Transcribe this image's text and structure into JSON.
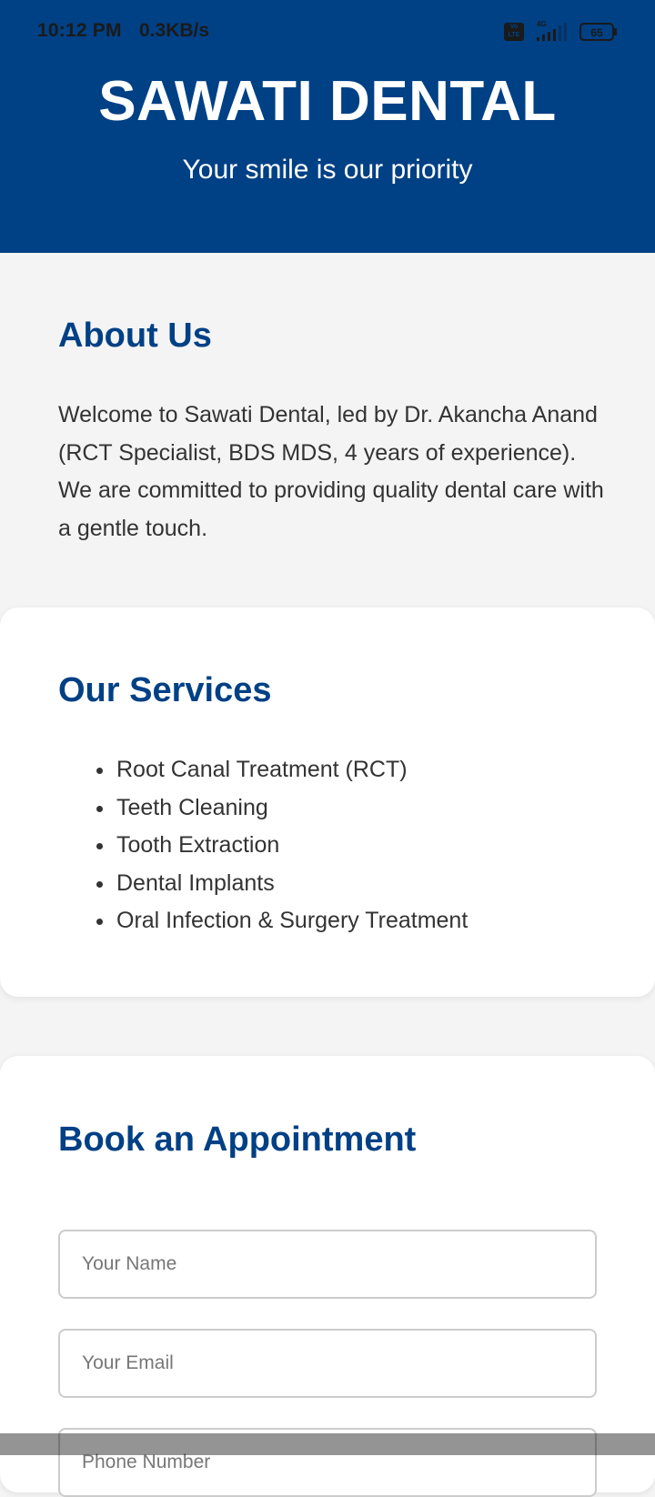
{
  "status_bar": {
    "time": "10:12 PM",
    "network_speed": "0.3KB/s",
    "volte_label_top": "Vo",
    "volte_label_bottom": "LTE",
    "network_type": "4G",
    "battery_level": "65"
  },
  "header": {
    "title": "SAWATI DENTAL",
    "tagline": "Your smile is our priority"
  },
  "about": {
    "heading": "About Us",
    "text": "Welcome to Sawati Dental, led by Dr. Akancha Anand (RCT Specialist, BDS MDS, 4 years of experience). We are committed to providing quality dental care with a gentle touch."
  },
  "services": {
    "heading": "Our Services",
    "items": [
      "Root Canal Treatment (RCT)",
      "Teeth Cleaning",
      "Tooth Extraction",
      "Dental Implants",
      "Oral Infection & Surgery Treatment"
    ]
  },
  "appointment": {
    "heading": "Book an Appointment",
    "name_placeholder": "Your Name",
    "email_placeholder": "Your Email",
    "phone_placeholder": "Phone Number"
  },
  "colors": {
    "brand": "#004085",
    "page_background": "#f4f4f4",
    "card_background": "#ffffff"
  },
  "icons": [
    "volte-icon",
    "signal-icon",
    "battery-icon"
  ]
}
